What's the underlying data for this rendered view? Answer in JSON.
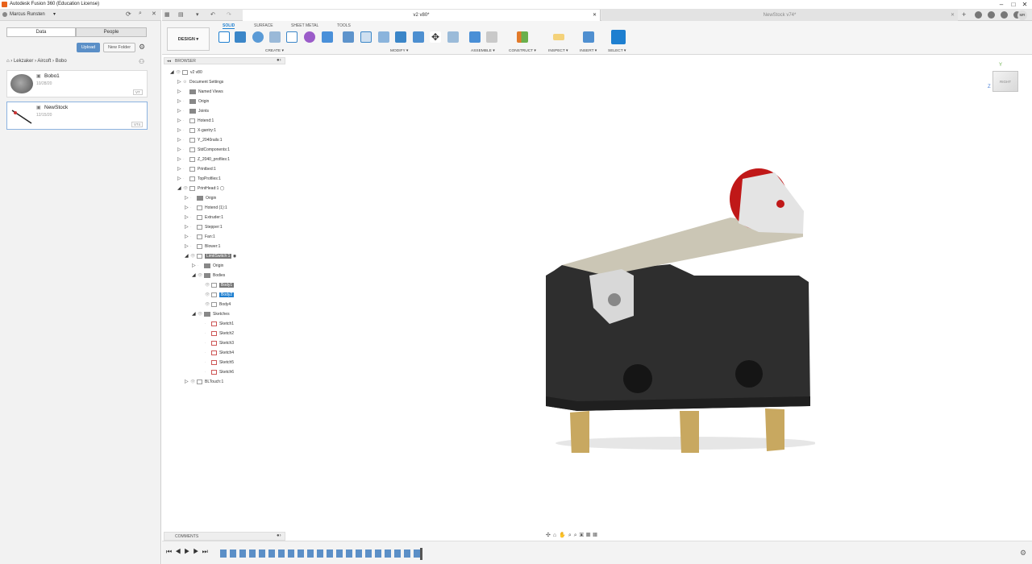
{
  "window": {
    "title": "Autodesk Fusion 360 (Education License)"
  },
  "user": {
    "name": "Marcus Runsten",
    "initials": "MR"
  },
  "data_panel": {
    "tabs": [
      "Data",
      "People"
    ],
    "upload_label": "Upload",
    "new_folder_label": "New Folder",
    "breadcrumb": [
      "Lekzaker",
      "Aircoft",
      "Bobo"
    ],
    "files": [
      {
        "name": "Bobo1",
        "date": "10/28/20",
        "version": "V7"
      },
      {
        "name": "NewStock",
        "date": "12/15/20",
        "version": "V74"
      }
    ]
  },
  "doc_tabs": [
    {
      "label": "v2 v80*",
      "active": true
    },
    {
      "label": "NewStock v74*",
      "active": false
    }
  ],
  "ribbon": {
    "workspace": "DESIGN",
    "tabs": [
      "SOLID",
      "SURFACE",
      "SHEET METAL",
      "TOOLS"
    ],
    "active_tab": "SOLID",
    "groups": [
      "CREATE",
      "MODIFY",
      "ASSEMBLE",
      "CONSTRUCT",
      "INSPECT",
      "INSERT",
      "SELECT"
    ]
  },
  "browser": {
    "title": "BROWSER",
    "root": "v2 v80",
    "items": [
      "Document Settings",
      "Named Views",
      "Origin",
      "Joints",
      "Hotend:1",
      "X-gantry:1",
      "Y_2040rails:1",
      "StdComponents:1",
      "Z_2040_profiles:1",
      "Printbed:1",
      "TopProfiles:1",
      "PrintHead:1"
    ],
    "printhead_children": [
      "Origin",
      "Hotend (1):1",
      "Extruder:1",
      "Stepper:1",
      "Fan:1",
      "Blower:1",
      "LimitSwitch:1"
    ],
    "limitswitch_children": [
      "Origin",
      "Bodies"
    ],
    "bodies": [
      "Body1",
      "Body2",
      "Body4"
    ],
    "sketches_label": "Sketches",
    "sketches": [
      "Sketch1",
      "Sketch2",
      "Sketch3",
      "Sketch4",
      "Sketch5",
      "Sketch6"
    ],
    "last_item": "BLTouch:1"
  },
  "viewcube": {
    "face": "RIGHT",
    "x_axis": "Z",
    "y_axis": "Y"
  },
  "comments": {
    "title": "COMMENTS"
  },
  "colors": {
    "accent": "#1e7fd0",
    "roller": "#d42020",
    "body": "#2b2b2b",
    "lever": "#cfcfcf",
    "pins": "#c8a860"
  }
}
